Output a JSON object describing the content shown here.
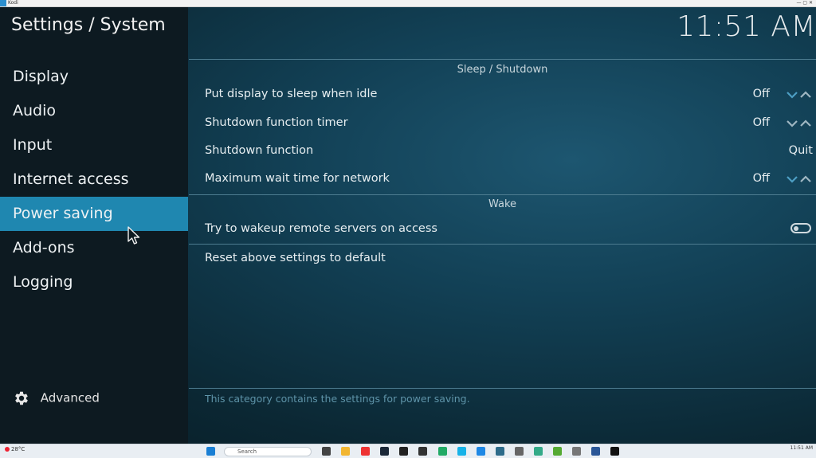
{
  "window": {
    "title": "Kodi"
  },
  "header": {
    "title": "Settings / System",
    "clock": "11:51 AM"
  },
  "sidebar": {
    "items": [
      {
        "label": "Display"
      },
      {
        "label": "Audio"
      },
      {
        "label": "Input"
      },
      {
        "label": "Internet access"
      },
      {
        "label": "Power saving",
        "active": true
      },
      {
        "label": "Add-ons"
      },
      {
        "label": "Logging"
      }
    ],
    "level": {
      "label": "Advanced"
    }
  },
  "sections": {
    "sleep": {
      "title": "Sleep / Shutdown",
      "rows": [
        {
          "label": "Put display to sleep when idle",
          "value": "Off"
        },
        {
          "label": "Shutdown function timer",
          "value": "Off"
        },
        {
          "label": "Shutdown function",
          "value": "Quit"
        },
        {
          "label": "Maximum wait time for network",
          "value": "Off"
        }
      ]
    },
    "wake": {
      "title": "Wake",
      "rows": [
        {
          "label": "Try to wakeup remote servers on access",
          "value": false
        }
      ]
    }
  },
  "reset": {
    "label": "Reset above settings to default"
  },
  "description": "This category contains the settings for power saving.",
  "taskbar": {
    "weather": "28°C",
    "search_placeholder": "Search",
    "time": "11:51 AM"
  },
  "colors": {
    "accent": "#1f87b0",
    "sidebar_bg": "#0d1a21",
    "description": "#5e93a8"
  }
}
